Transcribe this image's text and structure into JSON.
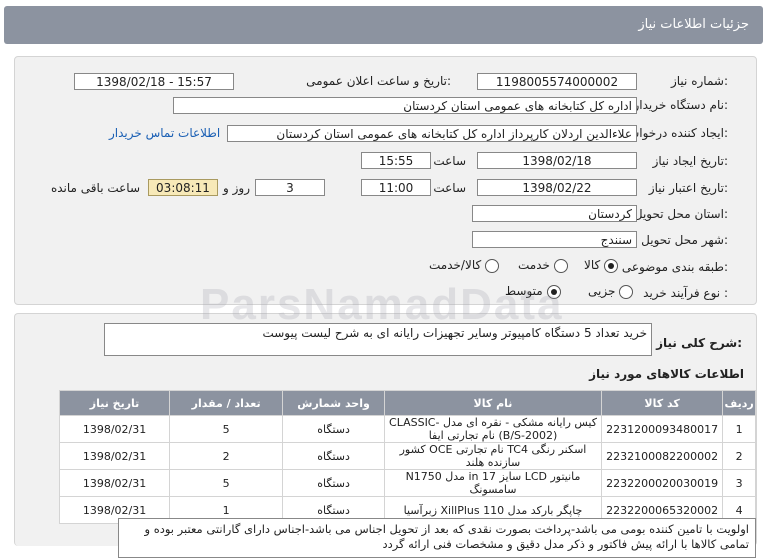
{
  "header": {
    "title": "جزئیات اطلاعات نیاز"
  },
  "form": {
    "need_number_label": "شماره نیاز:",
    "need_number": "1198005574000002",
    "announce_label": "تاریخ و ساعت اعلان عمومی:",
    "announce_value": "1398/02/18 - 15:57",
    "buyer_org_label": "نام دستگاه خریدار:",
    "buyer_org": "اداره کل کتابخانه های عمومی استان کردستان",
    "requester_label": "ایجاد کننده درخواست:",
    "requester": "علاءالدین اردلان کارپرداز اداره کل کتابخانه های عمومی استان کردستان",
    "contact_link": "اطلاعات تماس خریدار",
    "created_label": "تاریخ ایجاد نیاز:",
    "created_date": "1398/02/18",
    "time_label": "ساعت",
    "created_time": "15:55",
    "validity_label": "تاریخ اعتبار نیاز:",
    "validity_date": "1398/02/22",
    "validity_time": "11:00",
    "days": "3",
    "days_label": "روز و",
    "remaining": "03:08:11",
    "remaining_label": "ساعت باقی مانده",
    "province_label": "استان محل تحویل:",
    "province": "کردستان",
    "city_label": "شهر محل تحویل:",
    "city": "سنندج",
    "category_label": "طبقه بندی موضوعی:",
    "category_options": [
      "کالا",
      "خدمت",
      "کالا/خدمت"
    ],
    "category_selected": "کالا",
    "process_label": "نوع فرآیند خرید :",
    "process_options": [
      "جزیی",
      "متوسط"
    ],
    "process_selected": "متوسط"
  },
  "summary": {
    "label": "شرح کلی نیاز:",
    "text": "خرید تعداد 5 دستگاه کامپیوتر وسایر تجهیزات رایانه ای به شرح لیست پیوست"
  },
  "goods": {
    "section_title": "اطلاعات کالاهای مورد نیاز",
    "headers": [
      "ردیف",
      "کد کالا",
      "نام کالا",
      "واحد شمارش",
      "تعداد / مقدار",
      "تاریخ نیاز"
    ],
    "rows": [
      [
        "1",
        "2231200093480017",
        "کیس رایانه مشکی - نقره ای مدل CLASSIC-(B/S-2002) نام تجارتی ایفا",
        "دستگاه",
        "5",
        "1398/02/31"
      ],
      [
        "2",
        "2232100082200002",
        "اسکنر رنگی TC4 نام تجارتی OCE کشور سازنده هلند",
        "دستگاه",
        "2",
        "1398/02/31"
      ],
      [
        "3",
        "2232200020030019",
        "مانیتور LCD سایز in 17 مدل N1750 سامسونگ",
        "دستگاه",
        "5",
        "1398/02/31"
      ],
      [
        "4",
        "2232200065320002",
        "چاپگر بارکد مدل XillPlus 110 زبرآسیا",
        "دستگاه",
        "1",
        "1398/02/31"
      ]
    ]
  },
  "note": {
    "text": "اولویت با تامین کننده بومی می باشد-پرداخت بصورت نقدی که بعد از تحویل اجناس می باشد-اجناس دارای گارانتی معتبر بوده و تمامی کالاها با ارائه پیش فاکتور و ذکر مدل دقیق و مشخصات فنی ارائه گردد"
  },
  "watermark": {
    "text": "ParsNamadData"
  }
}
